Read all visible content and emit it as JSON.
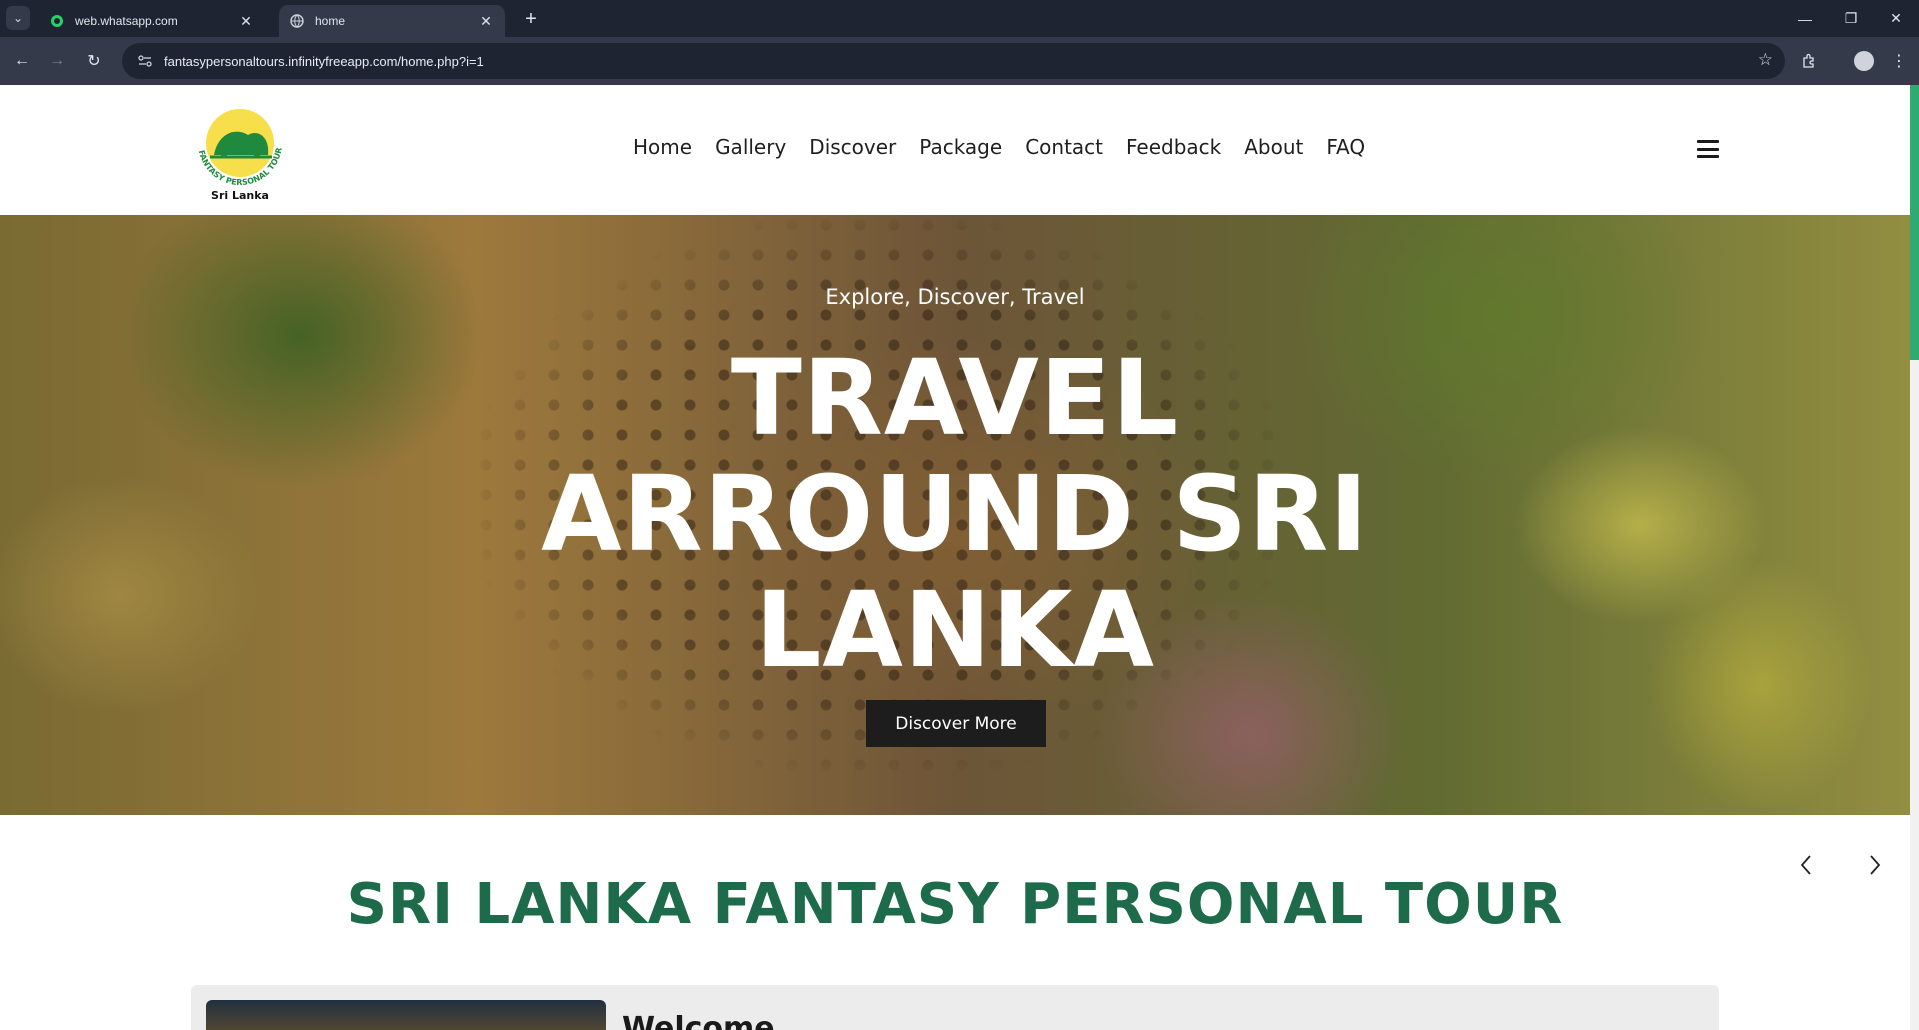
{
  "browser": {
    "tabs": [
      {
        "title": "web.whatsapp.com",
        "favicon": "whatsapp-icon",
        "active": false
      },
      {
        "title": "home",
        "favicon": "globe-icon",
        "active": true
      }
    ],
    "url": "fantasypersonaltours.infinityfreeapp.com/home.php?i=1"
  },
  "site": {
    "logo": {
      "text_top": "FANTASY PERSONAL TOUR",
      "text_bottom": "Sri Lanka"
    },
    "nav": [
      "Home",
      "Gallery",
      "Discover",
      "Package",
      "Contact",
      "Feedback",
      "About",
      "FAQ"
    ]
  },
  "hero": {
    "subtitle": "Explore, Discover, Travel",
    "title_lines": [
      "TRAVEL",
      "ARROUND SRI",
      "LANKA"
    ],
    "button": "Discover More"
  },
  "section": {
    "title": "SRI LANKA FANTASY PERSONAL TOUR",
    "welcome_title": "Welcome"
  },
  "colors": {
    "brand_green": "#1d6b4a",
    "scroll_accent": "#2faa70",
    "browser_dark": "#1f2433",
    "browser_mid": "#343a4a"
  }
}
